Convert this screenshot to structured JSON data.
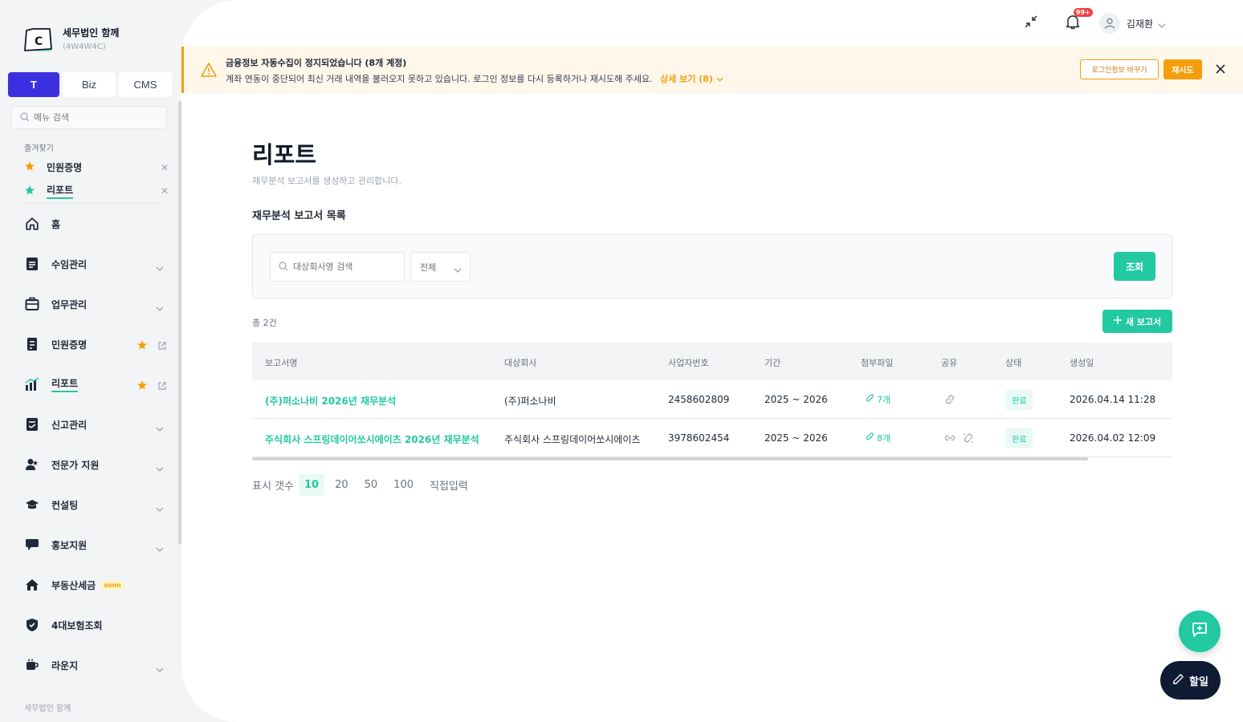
{
  "brand": {
    "name": "세무법인 함께",
    "code": "(4W4W4C)",
    "logo_letter": "C"
  },
  "mode_tabs": [
    {
      "label": "T"
    },
    {
      "label": "Biz"
    },
    {
      "label": "CMS"
    }
  ],
  "menu_search": {
    "placeholder": "메뉴 검색"
  },
  "favorites": {
    "title": "즐겨찾기",
    "items": [
      {
        "label": "민원증명",
        "color": "#f59e0b"
      },
      {
        "label": "리포트",
        "color": "#22c9a2"
      }
    ]
  },
  "nav": {
    "items": [
      {
        "label": "홈",
        "icon": "home-icon"
      },
      {
        "label": "수임관리",
        "icon": "document-icon"
      },
      {
        "label": "업무관리",
        "icon": "briefcase-icon"
      },
      {
        "label": "민원증명",
        "icon": "certificate-icon"
      },
      {
        "label": "리포트",
        "icon": "chart-icon"
      },
      {
        "label": "신고관리",
        "icon": "filing-icon"
      },
      {
        "label": "전문가 지원",
        "icon": "expert-icon"
      },
      {
        "label": "컨설팅",
        "icon": "graduation-cap-icon"
      },
      {
        "label": "홍보지원",
        "icon": "megaphone-icon"
      },
      {
        "label": "부동산세금",
        "icon": "house-icon",
        "badge": "soon"
      },
      {
        "label": "4대보험조회",
        "icon": "shield-icon"
      },
      {
        "label": "라운지",
        "icon": "coffee-icon"
      }
    ]
  },
  "sidebar_footer": "세무법인 함께",
  "topbar": {
    "notification_count": "99+",
    "user_name": "김재환"
  },
  "alert": {
    "title": "금융정보 자동수집이 정지되었습니다 (8개 계정)",
    "description": "계좌 연동이 중단되어 최신 거래 내역을 불러오지 못하고 있습니다. 로그인 정보를 다시 등록하거나 재시도해 주세요.",
    "more_label": "상세 보기 (8)",
    "change_login_label": "로그인정보 바꾸기",
    "retry_label": "재시도",
    "accent": "#f59e0b"
  },
  "page": {
    "title": "리포트",
    "description": "재무분석 보고서를 생성하고 관리합니다.",
    "section_title": "재무분석 보고서 목록"
  },
  "filter": {
    "search_placeholder": "대상회사명 검색",
    "select_value": "전체",
    "search_button": "조회"
  },
  "total_label": "총 2건",
  "new_report_label": "새 보고서",
  "table": {
    "columns": [
      "보고서명",
      "대상회사",
      "사업자번호",
      "기간",
      "첨부파일",
      "공유",
      "상태",
      "생성일"
    ],
    "rows": [
      {
        "name": "(주)퍼소나비 2026년 재무분석",
        "company": "(주)퍼소나비",
        "biz_no": "2458602809",
        "period": "2025 ~ 2026",
        "attachments": "7개",
        "status": "완료",
        "created": "2026.04.14 11:28"
      },
      {
        "name": "주식회사 스프링데이어쏘시에이츠 2026년 재무분석",
        "company": "주식회사 스프링데이어쏘시에이츠",
        "biz_no": "3978602454",
        "period": "2025 ~ 2026",
        "attachments": "8개",
        "status": "완료",
        "created": "2026.04.02 12:09"
      }
    ]
  },
  "page_size": {
    "label": "표시 갯수",
    "options": [
      "10",
      "20",
      "50",
      "100"
    ],
    "custom": "직접입력",
    "selected": "10"
  },
  "todo_label": "할일",
  "colors": {
    "primary": "#22c9a2",
    "brand_tab": "#3b30e0",
    "navy": "#0f1b33"
  }
}
